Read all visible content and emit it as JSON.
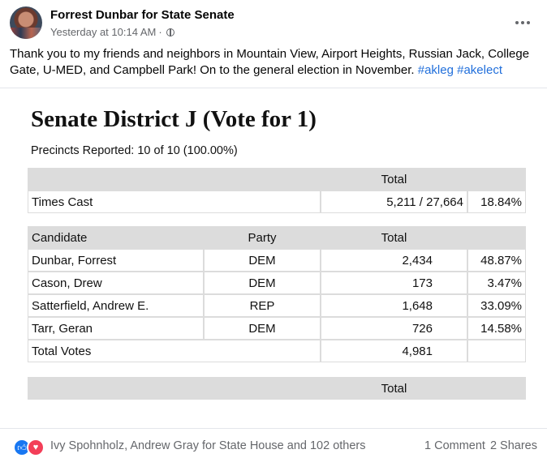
{
  "post": {
    "author": "Forrest Dunbar for State Senate",
    "timestamp": "Yesterday at 10:14 AM",
    "audience_separator": "·",
    "text": "Thank you to my friends and neighbors in Mountain View, Airport Heights, Russian Jack, College Gate, U-MED, and Campbell Park! On to the general election in November.",
    "hashtags": [
      "#akleg",
      "#akelect"
    ]
  },
  "results": {
    "title": "Senate District J (Vote for  1)",
    "precincts": "Precincts Reported: 10 of 10 (100.00%)",
    "times_cast": {
      "header_total": "Total",
      "label": "Times Cast",
      "value": "5,211 / 27,664",
      "percent": "18.84%"
    },
    "candidates_header": {
      "candidate": "Candidate",
      "party": "Party",
      "total": "Total"
    },
    "candidates": [
      {
        "name": "Dunbar, Forrest",
        "party": "DEM",
        "total": "2,434",
        "percent": "48.87%"
      },
      {
        "name": "Cason, Drew",
        "party": "DEM",
        "total": "173",
        "percent": "3.47%"
      },
      {
        "name": "Satterfield, Andrew E.",
        "party": "REP",
        "total": "1,648",
        "percent": "33.09%"
      },
      {
        "name": "Tarr, Geran",
        "party": "DEM",
        "total": "726",
        "percent": "14.58%"
      }
    ],
    "total_votes": {
      "label": "Total Votes",
      "value": "4,981"
    },
    "bottom_header_total": "Total"
  },
  "footer": {
    "reaction_names": "Ivy Spohnholz, Andrew Gray for State House and 102 others",
    "comments": "1 Comment",
    "shares": "2 Shares"
  },
  "colors": {
    "link": "#216fdb",
    "like": "#1877f2",
    "love": "#f33e58",
    "meta": "#65676b"
  },
  "icons": {
    "like": "like-icon",
    "love": "love-icon",
    "audience": "globe-icon",
    "more": "more-options-icon"
  }
}
